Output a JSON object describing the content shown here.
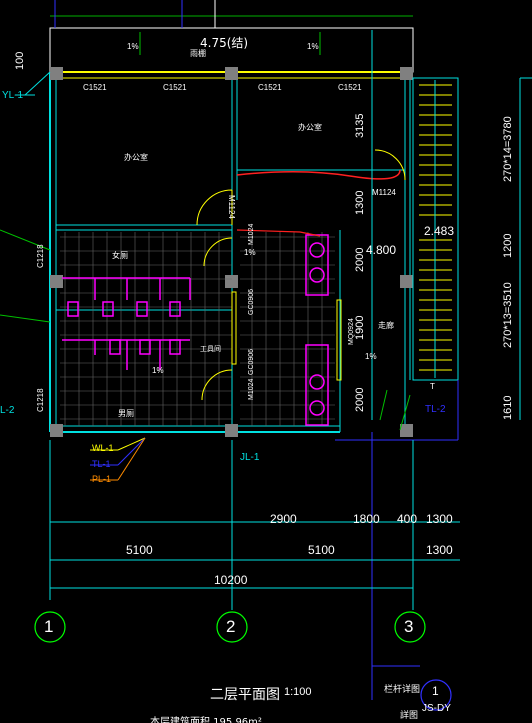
{
  "drawing": {
    "title": "二层平面图",
    "scale": "1:100",
    "bottom_note": "本层建筑面积 195.96m²",
    "slab_level": "4.75(结)",
    "canopy_label": "雨棚",
    "stair_level": "2.483",
    "floor_level": "4.800",
    "detail_label": "栏杆详图",
    "detail_ref": "詳图",
    "detail_num": "1",
    "detail_code": "JS-DY"
  },
  "rooms": {
    "office_left": "办公室",
    "office_right": "办公室",
    "wc_female": "女厕",
    "wc_male": "男厕",
    "tool_room": "工具间",
    "corridor": "走廊"
  },
  "windows": {
    "c1521": "C1521",
    "c1218": "C1218"
  },
  "doors": {
    "m1124": "M1124",
    "m1024": "M1024",
    "mq": "MQ0924",
    "gc": "GC0906"
  },
  "slope": "1%",
  "pipes": {
    "yl1": "YL-1",
    "l2": "L-2",
    "tl2": "TL-2",
    "jl1": "JL-1",
    "legend": [
      "WL-1",
      "TL-1",
      "PL-1"
    ]
  },
  "dims": {
    "top_100": "100",
    "right_3135": "3135",
    "right_1300": "1300",
    "right_2000": "2000",
    "right_1900": "1900",
    "right_2000b": "2000",
    "far_right_1": "270*14=3780",
    "far_right_2": "1200",
    "far_right_3": "270*13=3510",
    "far_right_4": "1610",
    "row1": [
      "2900",
      "1800",
      "400",
      "1300"
    ],
    "row2": [
      "5100",
      "5100",
      "1300"
    ],
    "total": "10200",
    "stair_t": "T"
  },
  "axes": [
    "1",
    "2",
    "3"
  ]
}
